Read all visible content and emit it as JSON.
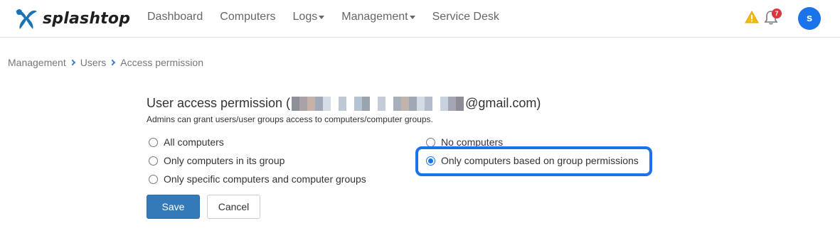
{
  "brand": {
    "name": "splashtop",
    "logo_color": "#1a73b8"
  },
  "nav": {
    "dashboard": "Dashboard",
    "computers": "Computers",
    "logs": "Logs",
    "management": "Management",
    "service_desk": "Service Desk"
  },
  "header_icons": {
    "warning": "warning-icon",
    "bell": "bell-icon",
    "notification_count": "7",
    "avatar_initial": "s"
  },
  "breadcrumb": {
    "item1": "Management",
    "item2": "Users",
    "item3": "Access permission"
  },
  "page": {
    "title_prefix": "User access permission (",
    "title_suffix": "@gmail.com)",
    "subtitle": "Admins can grant users/user groups access to computers/computer groups."
  },
  "options": {
    "all_computers": "All computers",
    "own_group": "Only computers in its group",
    "specific": "Only specific computers and computer groups",
    "no_computers": "No computers",
    "group_permissions": "Only computers based on group permissions",
    "selected": "group_permissions"
  },
  "buttons": {
    "save": "Save",
    "cancel": "Cancel"
  },
  "colors": {
    "accent": "#1a73e8",
    "save_button": "#337ab7",
    "badge": "#d9363e",
    "warning": "#f2b90f"
  }
}
